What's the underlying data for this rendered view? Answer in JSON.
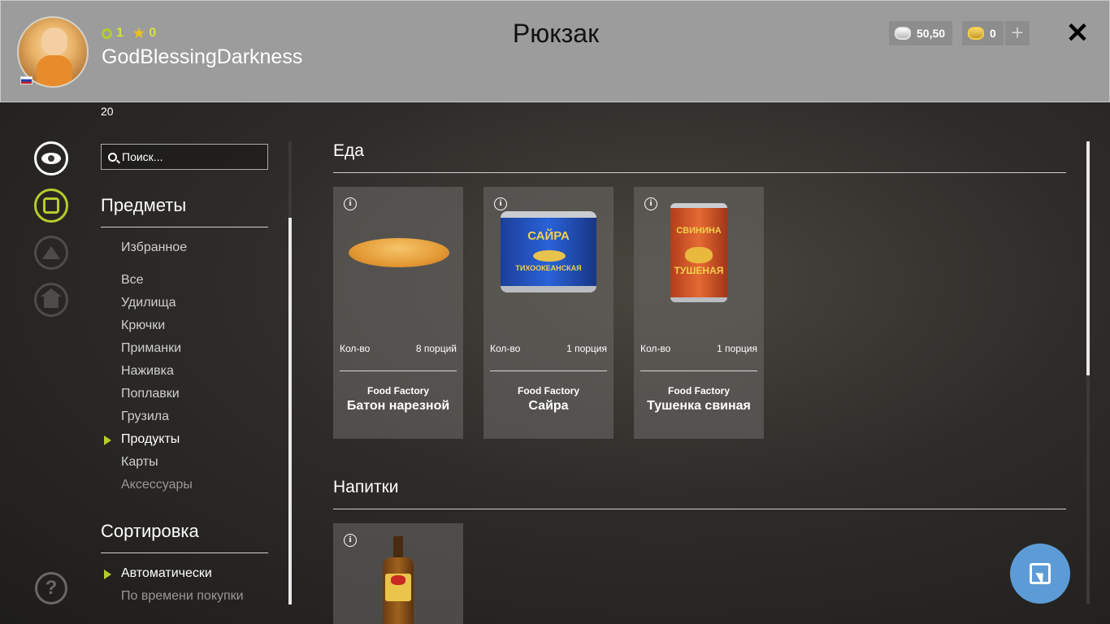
{
  "header": {
    "title": "Рюкзак",
    "username": "GodBlessingDarkness",
    "level": "1",
    "stars": "0",
    "level_number": "20",
    "silver": "50,50",
    "gold": "0",
    "plus_label": "+",
    "close_label": "✕"
  },
  "sidebar": {
    "search_placeholder": "Поиск...",
    "items_title": "Предметы",
    "favorites": "Избранное",
    "items": [
      "Все",
      "Удилища",
      "Крючки",
      "Приманки",
      "Наживка",
      "Поплавки",
      "Грузила",
      "Продукты",
      "Карты",
      "Аксессуары"
    ],
    "active_item": "Продукты",
    "sort_title": "Сортировка",
    "sort_options": [
      "Автоматически",
      "По времени покупки"
    ],
    "active_sort": "Автоматически"
  },
  "categories": [
    {
      "title": "Еда",
      "products": [
        {
          "qty_label": "Кол-во",
          "qty": "8 порций",
          "brand": "Food Factory",
          "name": "Батон нарезной",
          "image": "bread"
        },
        {
          "qty_label": "Кол-во",
          "qty": "1 порция",
          "brand": "Food Factory",
          "name": "Сайра",
          "image": "saury-can",
          "label_top": "САЙРА",
          "label_bottom": "ТИХООКЕАНСКАЯ"
        },
        {
          "qty_label": "Кол-во",
          "qty": "1 порция",
          "brand": "Food Factory",
          "name": "Тушенка свиная",
          "image": "pork-can",
          "label_top": "СВИНИНА",
          "label_bottom": "ТУШЕНАЯ"
        }
      ]
    },
    {
      "title": "Напитки",
      "products": [
        {
          "image": "drink-bottle"
        }
      ]
    }
  ],
  "colors": {
    "accent": "#b5cc2d",
    "header_bg": "#9c9c9c",
    "fab": "#5d9bd6"
  }
}
